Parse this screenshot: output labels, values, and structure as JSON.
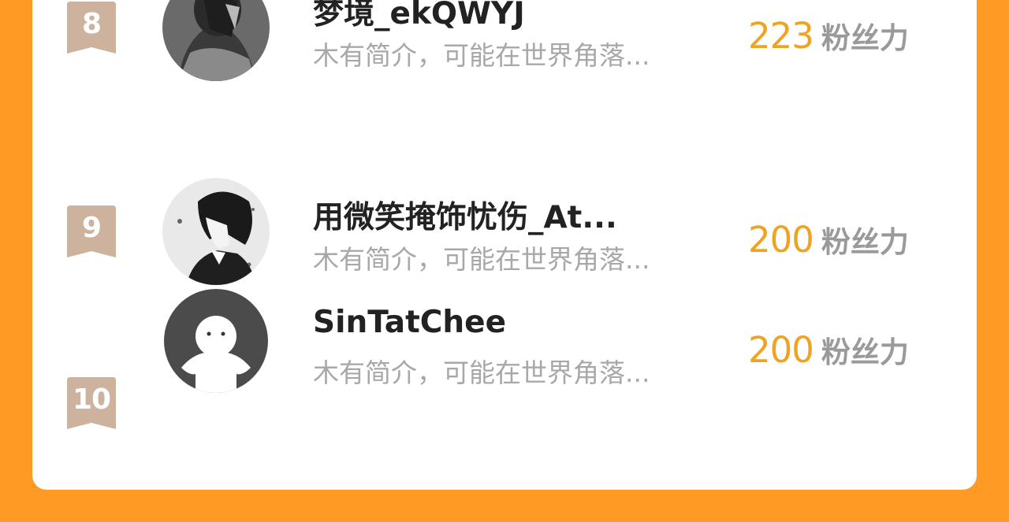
{
  "colors": {
    "background": "#ff9a24",
    "card": "#ffffff",
    "rank_badge": "#cdb39e",
    "fans_count": "#f0a321",
    "fans_label": "#9a9a9a",
    "name": "#222222",
    "description": "#a8a8a8"
  },
  "fans_label": "粉丝力",
  "rows": [
    {
      "rank": "8",
      "name": "梦境_ekQWYJ",
      "description": "木有简介，可能在世界角落...",
      "fans": "223",
      "avatar_icon": "avatar-dark-haired-figure-icon"
    },
    {
      "rank": "9",
      "name": "用微笑掩饰忧伤_At...",
      "description": "木有简介，可能在世界角落...",
      "fans": "200",
      "avatar_icon": "avatar-anime-boy-icon"
    },
    {
      "rank": "10",
      "name": "SinTatChee",
      "description": "木有简介，可能在世界角落...",
      "fans": "200",
      "avatar_icon": "avatar-default-person-icon"
    }
  ]
}
